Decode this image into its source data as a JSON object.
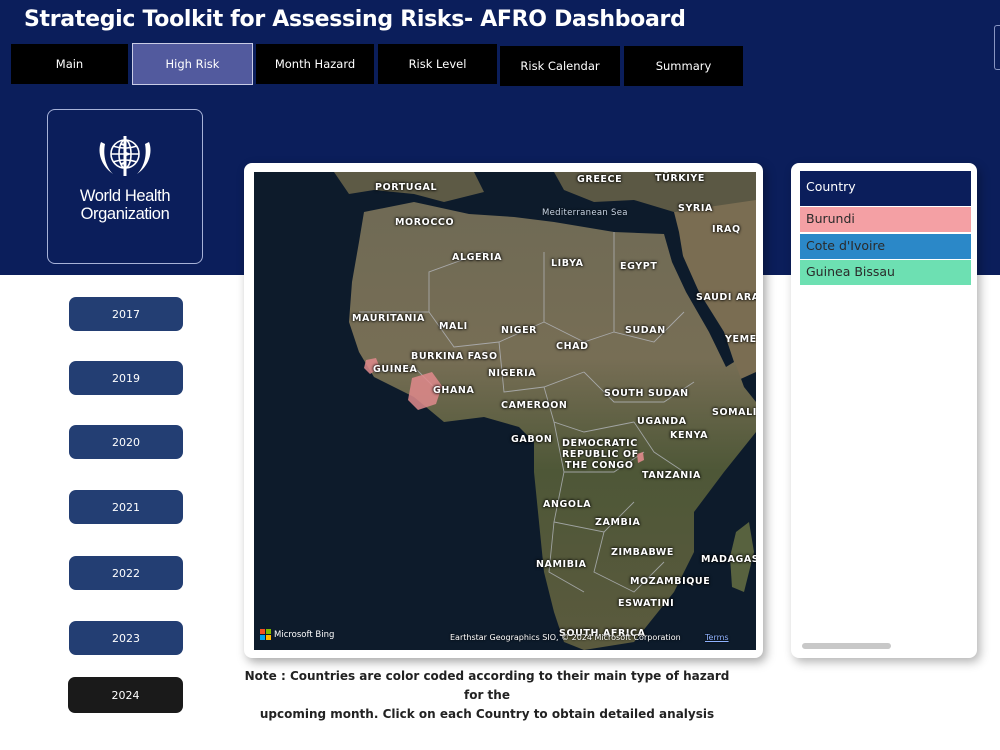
{
  "header": {
    "title": "Strategic Toolkit for Assessing Risks- AFRO Dashboard"
  },
  "nav": {
    "tabs": [
      {
        "label": "Main"
      },
      {
        "label": "High Risk"
      },
      {
        "label": "Month Hazard"
      },
      {
        "label": "Risk Level"
      },
      {
        "label": "Risk Calendar"
      },
      {
        "label": "Summary"
      }
    ],
    "active_tab": "High Risk"
  },
  "logo": {
    "line1": "World Health",
    "line2": "Organization",
    "icon": "who-emblem-icon"
  },
  "years": {
    "items": [
      {
        "label": "2017"
      },
      {
        "label": "2019"
      },
      {
        "label": "2020"
      },
      {
        "label": "2021"
      },
      {
        "label": "2022"
      },
      {
        "label": "2023"
      },
      {
        "label": "2024"
      }
    ],
    "selected": "2024"
  },
  "map": {
    "countries": [
      "PORTUGAL",
      "GREECE",
      "TÜRKIYE",
      "SYRIA",
      "IRAQ",
      "MOROCCO",
      "ALGERIA",
      "LIBYA",
      "EGYPT",
      "SAUDI ARA",
      "MAURITANIA",
      "MALI",
      "NIGER",
      "SUDAN",
      "CHAD",
      "YEME",
      "BURKINA FASO",
      "GUINEA",
      "NIGERIA",
      "GHANA",
      "SOUTH SUDAN",
      "CAMEROON",
      "SOMALI",
      "UGANDA",
      "KENYA",
      "GABON",
      "DEMOCRATIC",
      "REPUBLIC OF",
      "THE CONGO",
      "TANZANIA",
      "ANGOLA",
      "ZAMBIA",
      "ZIMBABWE",
      "MADAGAS",
      "NAMIBIA",
      "MOZAMBIQUE",
      "ESWATINI",
      "SOUTH AFRICA"
    ],
    "seas": [
      "Mediterranean Sea"
    ],
    "provider": "Microsoft Bing",
    "attribution": "Earthstar Geographics SIO, © 2024 Microsoft Corporation",
    "terms": "Terms"
  },
  "slicer": {
    "header": "Country",
    "items": [
      {
        "label": "Burundi",
        "color": "#f4a0a4"
      },
      {
        "label": "Cote d'Ivoire",
        "color": "#2b88c8"
      },
      {
        "label": "Guinea Bissau",
        "color": "#6de0b2"
      }
    ]
  },
  "note": {
    "line1": "Note : Countries are color coded according to their main type of hazard for the",
    "line2": "upcoming month. Click on each Country to obtain detailed analysis"
  },
  "colors": {
    "banner": "#0b1e5b",
    "year_button": "#233e73",
    "year_selected": "#1a1a1a",
    "nav_active": "#525a9e",
    "highlight_country": "#e08a8c"
  }
}
